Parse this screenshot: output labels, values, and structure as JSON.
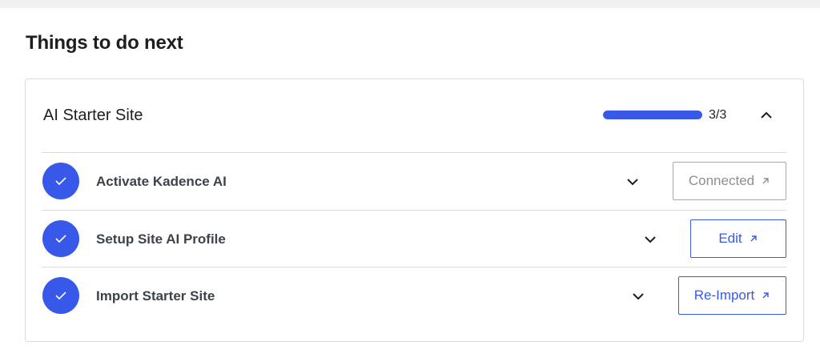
{
  "page": {
    "title": "Things to do next"
  },
  "card": {
    "title": "AI Starter Site",
    "progress": {
      "completed": 3,
      "total": 3,
      "label": "3/3",
      "color": "#3858e9"
    },
    "collapse_icon": "chevron-up-icon"
  },
  "tasks": [
    {
      "label": "Activate Kadence AI",
      "status": "done",
      "action_label": "Connected",
      "action_disabled": true,
      "action_icon": "external-arrow-icon"
    },
    {
      "label": "Setup Site AI Profile",
      "status": "done",
      "action_label": "Edit",
      "action_disabled": false,
      "action_icon": "external-arrow-icon"
    },
    {
      "label": "Import Starter Site",
      "status": "done",
      "action_label": "Re-Import",
      "action_disabled": false,
      "action_icon": "external-arrow-icon"
    }
  ],
  "colors": {
    "accent": "#3858e9",
    "border": "#dcdcde",
    "muted": "#8c8f94"
  }
}
